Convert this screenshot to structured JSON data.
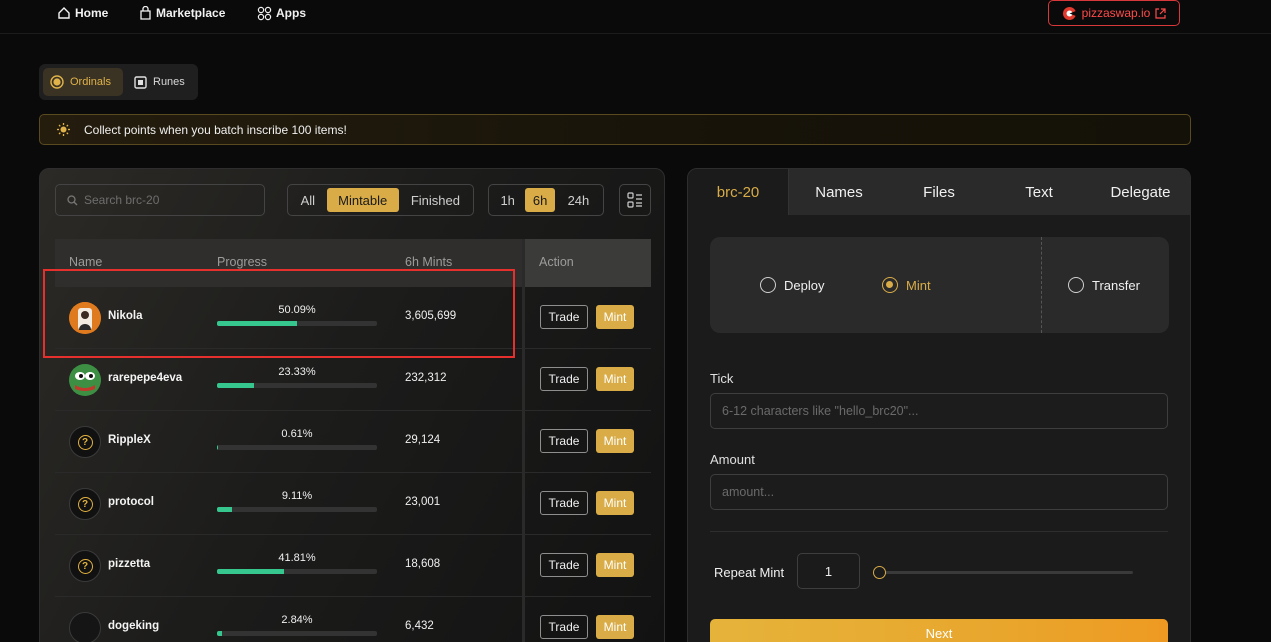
{
  "nav": {
    "home": "Home",
    "marketplace": "Marketplace",
    "apps": "Apps",
    "pizzaswap": "pizzaswap.io"
  },
  "protocol_toggle": {
    "ordinals": "Ordinals",
    "runes": "Runes",
    "selected": "Ordinals"
  },
  "banner": {
    "text": "Collect points when you batch inscribe 100 items!"
  },
  "list_panel": {
    "search_placeholder": "Search brc-20",
    "filters": [
      "All",
      "Mintable",
      "Finished"
    ],
    "active_filter": "Mintable",
    "time_ranges": [
      "1h",
      "6h",
      "24h"
    ],
    "active_time_range": "6h",
    "columns": {
      "name": "Name",
      "progress": "Progress",
      "mints": "6h Mints",
      "action": "Action"
    },
    "rows": [
      {
        "name": "Nikola",
        "progress_label": "50.09%",
        "progress": 50.09,
        "mints": "3,605,699",
        "trade": "Trade",
        "mint": "Mint",
        "avatar": "nikola-portrait"
      },
      {
        "name": "rarepepe4eva",
        "progress_label": "23.33%",
        "progress": 23.33,
        "mints": "232,312",
        "trade": "Trade",
        "mint": "Mint",
        "avatar": "pepe-frog"
      },
      {
        "name": "RippleX",
        "progress_label": "0.61%",
        "progress": 0.61,
        "mints": "29,124",
        "trade": "Trade",
        "mint": "Mint",
        "avatar": "question-mark"
      },
      {
        "name": "protocol",
        "progress_label": "9.11%",
        "progress": 9.11,
        "mints": "23,001",
        "trade": "Trade",
        "mint": "Mint",
        "avatar": "question-mark"
      },
      {
        "name": "pizzetta",
        "progress_label": "41.81%",
        "progress": 41.81,
        "mints": "18,608",
        "trade": "Trade",
        "mint": "Mint",
        "avatar": "question-mark"
      },
      {
        "name": "dogeking",
        "progress_label": "2.84%",
        "progress": 2.84,
        "mints": "6,432",
        "trade": "Trade",
        "mint": "Mint",
        "avatar": "blank"
      }
    ]
  },
  "inscribe_panel": {
    "tabs": [
      "brc-20",
      "Names",
      "Files",
      "Text",
      "Delegate"
    ],
    "active_tab": "brc-20",
    "operations": [
      "Deploy",
      "Mint",
      "Transfer"
    ],
    "selected_operation": "Mint",
    "tick_label": "Tick",
    "tick_placeholder": "6-12 characters like \"hello_brc20\"...",
    "amount_label": "Amount",
    "amount_placeholder": "amount...",
    "repeat_label": "Repeat Mint",
    "repeat_value": "1",
    "next_label": "Next"
  },
  "colors": {
    "accent_gold": "#d9ac47",
    "progress_green": "#36c78f",
    "highlight_red": "#e5302e",
    "brand_red": "#ff4a4a"
  }
}
